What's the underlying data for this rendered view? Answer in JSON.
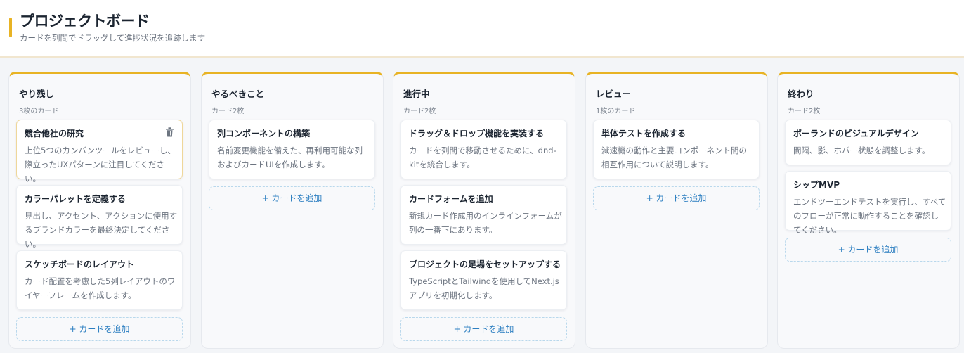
{
  "header": {
    "title": "プロジェクトボード",
    "subtitle": "カードを列間でドラッグして進捗状況を追跡します"
  },
  "columns": [
    {
      "title": "やり残し",
      "count": "3枚のカード",
      "cards": [
        {
          "title": "競合他社の研究",
          "desc": "上位5つのカンバンツールをレビューし、際立ったUXパターンに注目してください。"
        },
        {
          "title": "カラーパレットを定義する",
          "desc": "見出し、アクセント、アクションに使用するブランドカラーを最終決定してください。"
        },
        {
          "title": "スケッチボードのレイアウト",
          "desc": "カード配置を考慮した5列レイアウトのワイヤーフレームを作成します。"
        }
      ]
    },
    {
      "title": "やるべきこと",
      "count": "カード2枚",
      "cards": [
        {
          "title": "列コンポーネントの構築",
          "desc": "名前変更機能を備えた、再利用可能な列およびカードUIを作成します。"
        }
      ]
    },
    {
      "title": "進行中",
      "count": "カード2枚",
      "cards": [
        {
          "title": "ドラッグ＆ドロップ機能を実装する",
          "desc": "カードを列間で移動させるために、dnd-kitを統合します。"
        },
        {
          "title": "カードフォームを追加",
          "desc": "新規カード作成用のインラインフォームが列の一番下にあります。"
        },
        {
          "title": "プロジェクトの足場をセットアップする",
          "desc": "TypeScriptとTailwindを使用してNext.jsアプリを初期化します。"
        }
      ]
    },
    {
      "title": "レビュー",
      "count": "1枚のカード",
      "cards": [
        {
          "title": "単体テストを作成する",
          "desc": "減速機の動作と主要コンポーネント間の相互作用について説明します。"
        }
      ]
    },
    {
      "title": "終わり",
      "count": "カード2枚",
      "cards": [
        {
          "title": "ポーランドのビジュアルデザイン",
          "desc": "間隔、影、ホバー状態を調整します。"
        },
        {
          "title": "シップMVP",
          "desc": "エンドツーエンドテストを実行し、すべてのフローが正常に動作することを確認してください。"
        }
      ]
    }
  ],
  "add_card_label": "+ カードを追加",
  "icons": {
    "delete": "trash-icon"
  },
  "colors": {
    "accent": "#e8b324",
    "link": "#2d7fc1",
    "dashed_border": "#b9d8ec"
  }
}
